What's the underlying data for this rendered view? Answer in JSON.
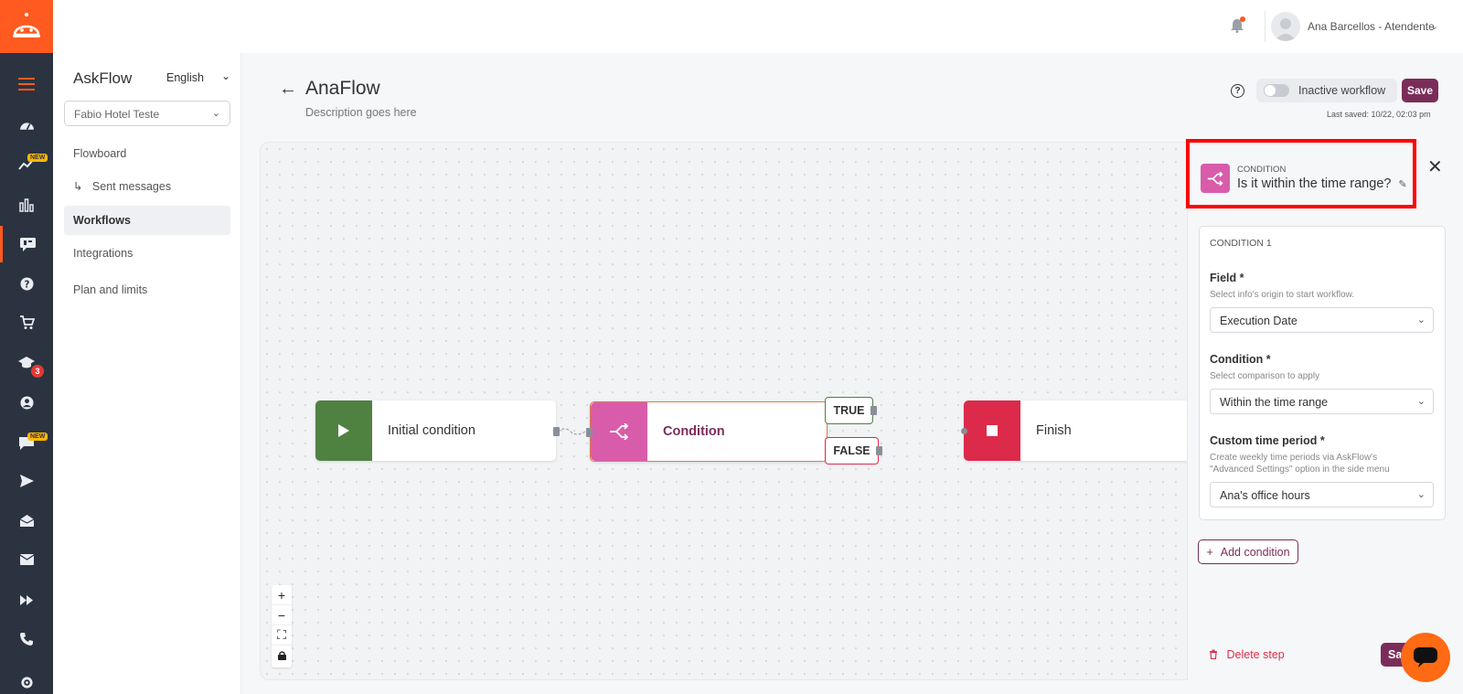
{
  "colors": {
    "brand_orange": "#ff5a1f",
    "rail_bg": "#2b3340",
    "primary_purple": "#7b2d5a",
    "node_start_green": "#4f8141",
    "node_condition_pink": "#d95cab",
    "node_finish_red": "#dc2a4b",
    "highlight_red": "#ff0000"
  },
  "rail": {
    "items": [
      {
        "icon": "menu-icon",
        "active": false
      },
      {
        "icon": "dashboard-icon",
        "active": false
      },
      {
        "icon": "trending-icon",
        "badge": "NEW",
        "active": false
      },
      {
        "icon": "bar-chart-icon",
        "active": false
      },
      {
        "icon": "askflow-icon",
        "active": true
      },
      {
        "icon": "help-icon",
        "active": false
      },
      {
        "icon": "cart-icon",
        "active": false
      },
      {
        "icon": "graduation-icon",
        "badge_count": "3",
        "active": false
      },
      {
        "icon": "user-circle-icon",
        "active": false
      },
      {
        "icon": "chat-icon",
        "badge": "NEW",
        "active": false
      },
      {
        "icon": "send-icon",
        "active": false
      },
      {
        "icon": "envelope-open-icon",
        "active": false
      },
      {
        "icon": "mail-icon",
        "active": false
      },
      {
        "icon": "fast-forward-icon",
        "active": false
      },
      {
        "icon": "phone-icon",
        "active": false
      },
      {
        "icon": "settings-icon",
        "active": false
      }
    ]
  },
  "header": {
    "user_name": "Ana Barcellos - Atendente"
  },
  "sidebar": {
    "app_name": "AskFlow",
    "language": "English",
    "hotel": "Fabio Hotel Teste",
    "items": {
      "flowboard": "Flowboard",
      "sent_messages": "Sent messages",
      "workflows": "Workflows",
      "integrations": "Integrations",
      "plan": "Plan and limits"
    },
    "sub_arrow": "↳"
  },
  "workflow": {
    "title": "AnaFlow",
    "description": "Description goes here",
    "status_label": "Inactive workflow",
    "status_active": false,
    "save_label": "Save",
    "last_saved": "Last saved: 10/22, 02:03 pm"
  },
  "canvas": {
    "nodes": {
      "start": "Initial condition",
      "condition": "Condition",
      "finish": "Finish"
    },
    "branches": {
      "true": "TRUE",
      "false": "FALSE"
    }
  },
  "panel": {
    "kicker": "CONDITION",
    "title": "Is it within the time range?",
    "condition_heading": "CONDITION 1",
    "field": {
      "label": "Field *",
      "help": "Select info's origin to start workflow.",
      "value": "Execution Date"
    },
    "condition": {
      "label": "Condition *",
      "help": "Select comparison to apply",
      "value": "Within the time range"
    },
    "custom_period": {
      "label": "Custom time period *",
      "help_line1": "Create weekly time periods via AskFlow's",
      "help_line2": "\"Advanced Settings\" option in the side menu",
      "value": "Ana's office hours"
    },
    "add_condition": "Add condition",
    "delete_step": "Delete step",
    "save_label": "Save"
  }
}
